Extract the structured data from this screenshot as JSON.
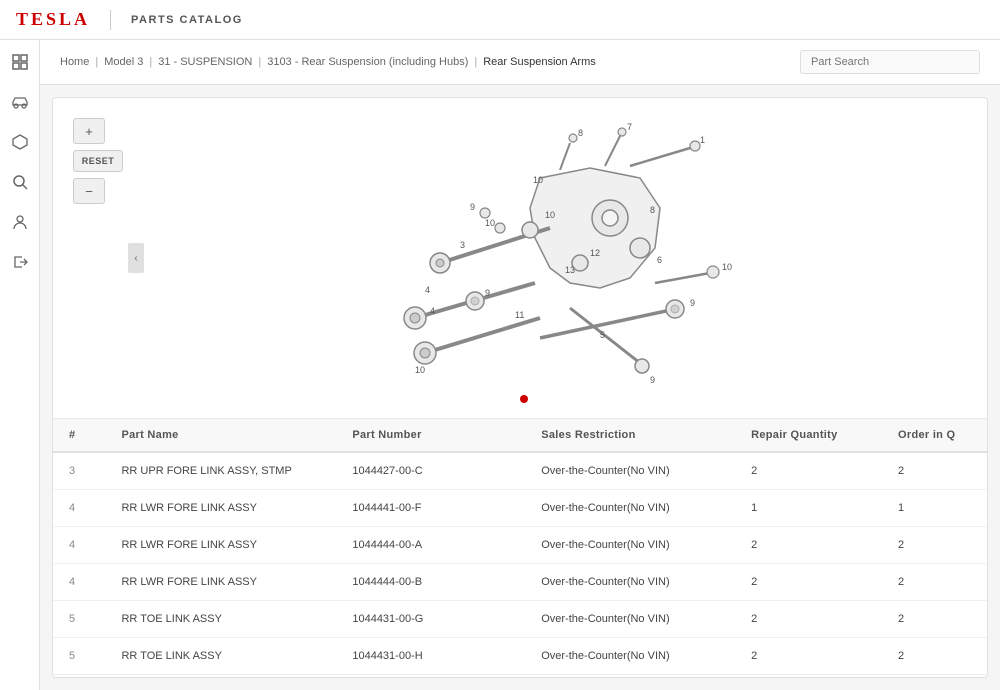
{
  "header": {
    "logo": "TESLA",
    "catalog_label": "PARTS CATALOG"
  },
  "breadcrumb": {
    "items": [
      "Home",
      "Model 3",
      "31 - SUSPENSION",
      "3103 - Rear Suspension (including Hubs)",
      "Rear Suspension Arms"
    ]
  },
  "search": {
    "placeholder": "Part Search"
  },
  "sidebar": {
    "icons": [
      {
        "name": "grid-icon",
        "symbol": "⊞"
      },
      {
        "name": "car-icon",
        "symbol": "🚗"
      },
      {
        "name": "parts-icon",
        "symbol": "⬡"
      },
      {
        "name": "search-icon",
        "symbol": "🔍"
      },
      {
        "name": "user-icon",
        "symbol": "👤"
      },
      {
        "name": "logout-icon",
        "symbol": "↪"
      }
    ]
  },
  "controls": {
    "zoom_in": "+",
    "zoom_out": "−",
    "reset": "RESET"
  },
  "table": {
    "columns": [
      "#",
      "Part Name",
      "Part Number",
      "Sales Restriction",
      "Repair Quantity",
      "Order in Q"
    ],
    "rows": [
      {
        "num": "3",
        "name": "RR UPR FORE LINK ASSY, STMP",
        "part_number": "1044427-00-C",
        "sales": "Over-the-Counter(No VIN)",
        "repair_qty": "2",
        "order_qty": "2"
      },
      {
        "num": "4",
        "name": "RR LWR FORE LINK ASSY",
        "part_number": "1044441-00-F",
        "sales": "Over-the-Counter(No VIN)",
        "repair_qty": "1",
        "order_qty": "1"
      },
      {
        "num": "4",
        "name": "RR LWR FORE LINK ASSY",
        "part_number": "1044444-00-A",
        "sales": "Over-the-Counter(No VIN)",
        "repair_qty": "2",
        "order_qty": "2"
      },
      {
        "num": "4",
        "name": "RR LWR FORE LINK ASSY",
        "part_number": "1044444-00-B",
        "sales": "Over-the-Counter(No VIN)",
        "repair_qty": "2",
        "order_qty": "2"
      },
      {
        "num": "5",
        "name": "RR TOE LINK ASSY",
        "part_number": "1044431-00-G",
        "sales": "Over-the-Counter(No VIN)",
        "repair_qty": "2",
        "order_qty": "2"
      },
      {
        "num": "5",
        "name": "RR TOE LINK ASSY",
        "part_number": "1044431-00-H",
        "sales": "Over-the-Counter(No VIN)",
        "repair_qty": "2",
        "order_qty": "2"
      }
    ]
  },
  "colors": {
    "tesla_red": "#cc0000",
    "border": "#e0e0e0",
    "bg_light": "#f5f5f5"
  }
}
